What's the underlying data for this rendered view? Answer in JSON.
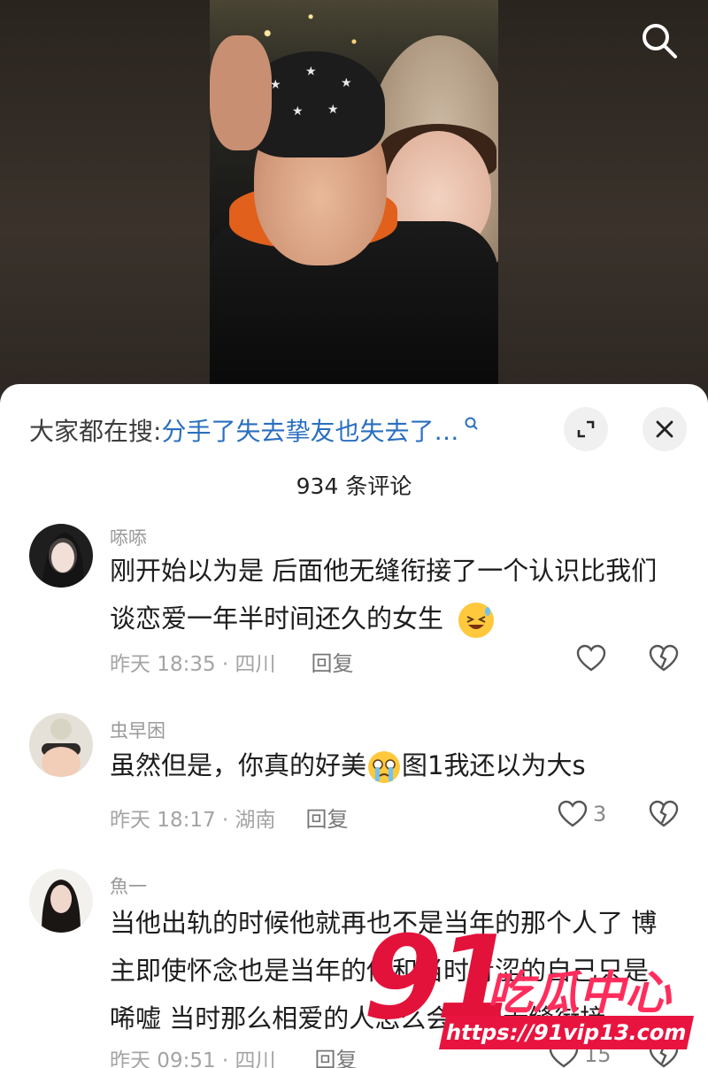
{
  "search_bar": {
    "prefix": "大家都在搜:",
    "query": "分手了失去挚友也失去了…"
  },
  "comment_count_title": "934 条评论",
  "comments": [
    {
      "username": "㖭㖭",
      "text_line1": "刚开始以为是 后面他无缝衔接了一个认识比我们",
      "text_line2": "谈恋爱一年半时间还久的女生",
      "emoji": "grinning-sweat-emoji",
      "time_location": "昨天 18:35 · 四川",
      "reply_label": "回复",
      "like_count": ""
    },
    {
      "username": "虫早困",
      "text_before_emoji": "虽然但是，你真的好美",
      "text_after_emoji": "图1我还以为大s",
      "emoji": "crying-face-emoji",
      "time_location": "昨天 18:17 · 湖南",
      "reply_label": "回复",
      "like_count": "3"
    },
    {
      "username": "魚一",
      "text_line1": "当他出轨的时候他就再也不是当年的那个人了 博",
      "text_line2": "主即使怀念也是当年的他和当时青涩的自己只是",
      "text_line3": "唏嘘 当时那么相爱的人怎么会做到无缝衔接",
      "time_location": "昨天 09:51 · 四川",
      "reply_label": "回复",
      "like_count": "15"
    }
  ],
  "watermark": {
    "number": "91",
    "name": "吃瓜中心",
    "url": "https://91vip13.com"
  },
  "colors": {
    "link_blue": "#2a6fbf",
    "watermark_red": "#e3123b"
  }
}
